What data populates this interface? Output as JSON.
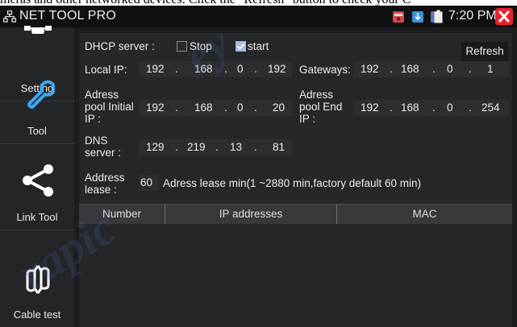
{
  "caption": "meras and other networked devices. Click the \"Refresh\" button to check your C",
  "app": {
    "title": "NET TOOL PRO"
  },
  "status": {
    "time": "7:20 PM"
  },
  "sidebar": {
    "items": [
      {
        "label": "Setting",
        "icon": "gear-icon"
      },
      {
        "label": "Tool",
        "icon": "wrench-icon"
      },
      {
        "label": "Link Tool",
        "icon": "share-icon"
      },
      {
        "label": "Cable test",
        "icon": "cable-test-icon"
      }
    ]
  },
  "dhcp": {
    "label": "DHCP server :",
    "stop_label": "Stop",
    "start_label": "start",
    "stop_checked": false,
    "start_checked": true,
    "refresh_label": "Refresh"
  },
  "fields": {
    "local_ip": {
      "label": "Local IP:",
      "octets": [
        "192",
        "168",
        "0",
        "192"
      ]
    },
    "gateways": {
      "label": "Gateways:",
      "octets": [
        "192",
        "168",
        "0",
        "1"
      ]
    },
    "pool_initial": {
      "label": "Adress\npool Initial\nIP :",
      "octets": [
        "192",
        "168",
        "0",
        "20"
      ]
    },
    "pool_end": {
      "label": "Adress\npool End\nIP :",
      "octets": [
        "192",
        "168",
        "0",
        "254"
      ]
    },
    "dns": {
      "label": "DNS\nserver :",
      "octets": [
        "129",
        "219",
        "13",
        "81"
      ]
    },
    "lease": {
      "label": "Address\nlease :",
      "value": "60",
      "note": "Adress lease min(1 ~2880 min,factory default 60 min)"
    }
  },
  "table": {
    "columns": [
      "Number",
      "IP addresses",
      "MAC"
    ]
  },
  "colors": {
    "close": "#e4242c",
    "accent_check": "#a6bde0",
    "panel": "#262729"
  }
}
